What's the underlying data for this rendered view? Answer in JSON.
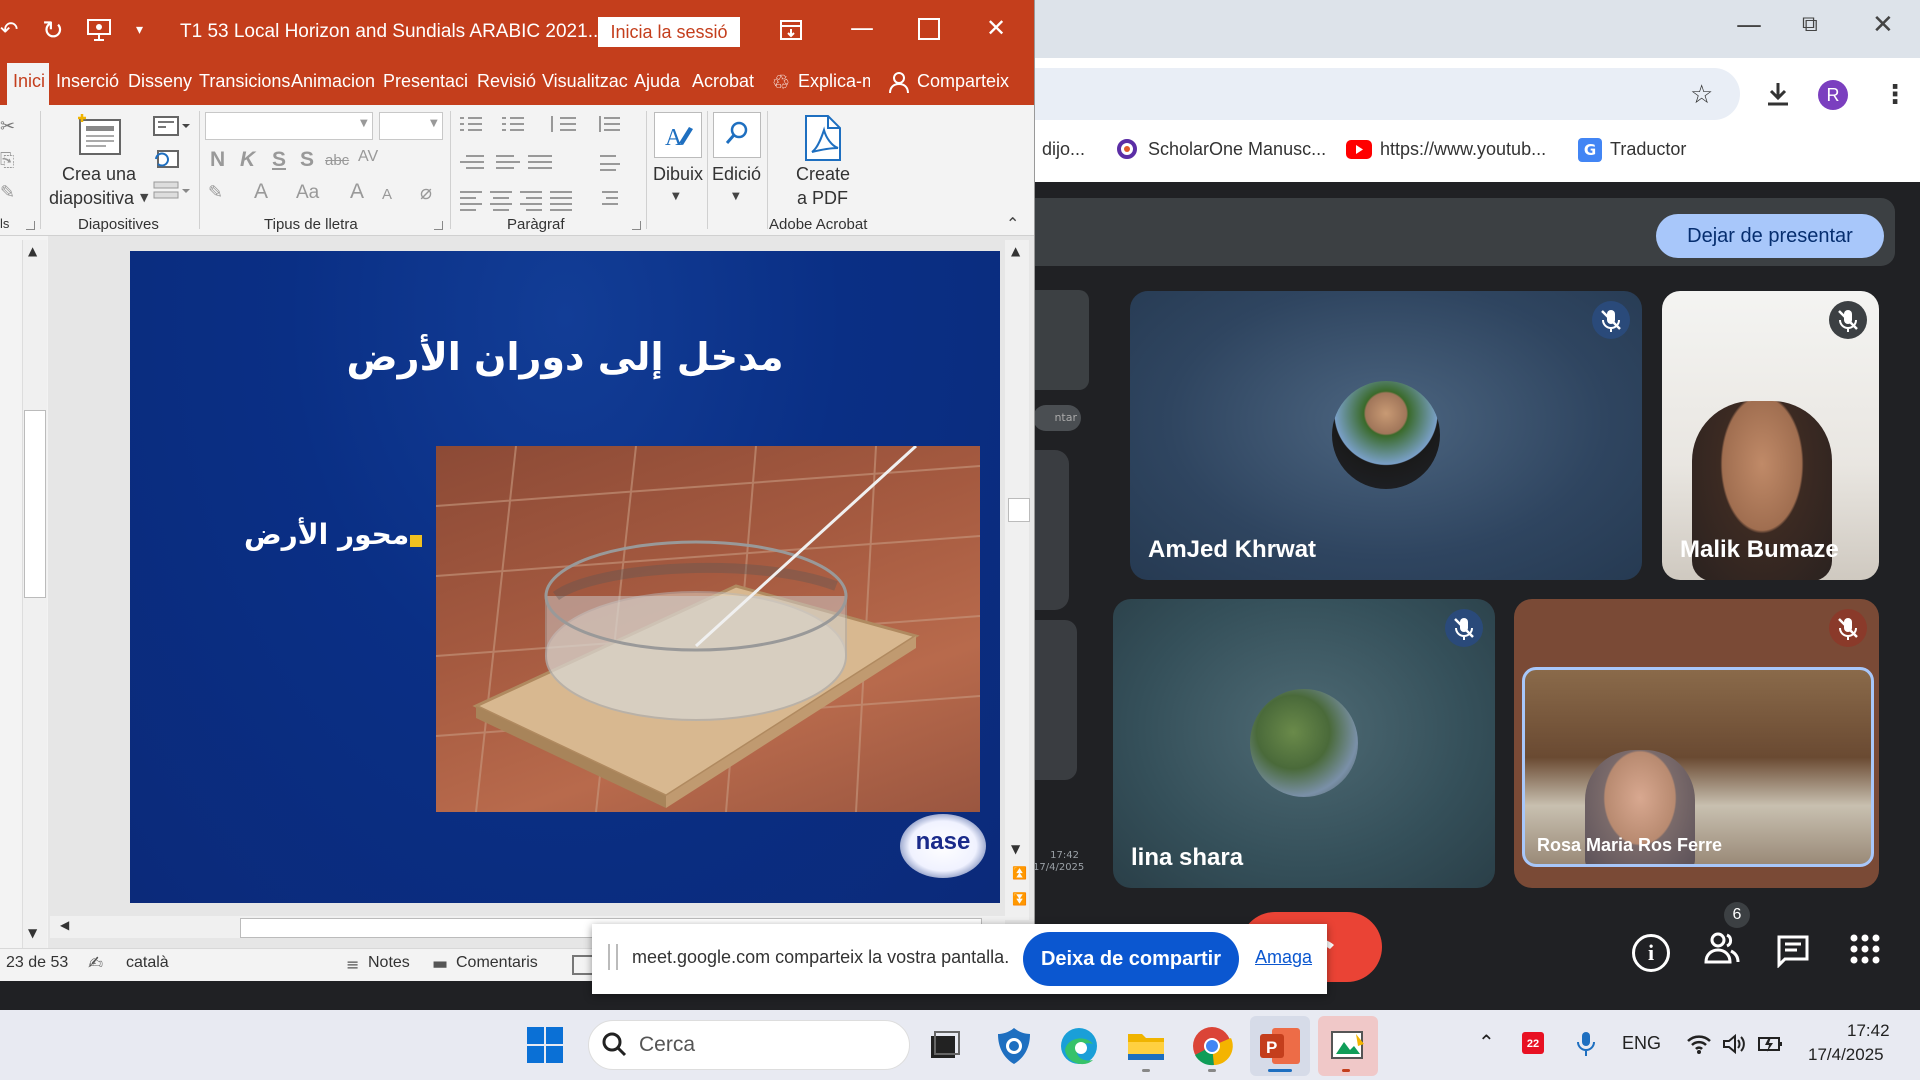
{
  "ppt": {
    "doc_title": "T1 53 Local Horizon and Sundials ARABIC 2021....",
    "signin_label": "Inicia la sessió",
    "tabs": [
      "Inici",
      "Inserció",
      "Disseny",
      "Transicions",
      "Animacion",
      "Presentacic",
      "Revisió",
      "Visualitzac",
      "Ajuda",
      "Acrobat"
    ],
    "tell_me": "Explica-m",
    "share": "Comparteix",
    "ribbon": {
      "new_slide_line1": "Crea una",
      "new_slide_line2": "diapositiva",
      "group_slides": "Diapositives",
      "group_font": "Tipus de lletra",
      "group_paragraph": "Paràgraf",
      "draw": "Dibuix",
      "edit": "Edició",
      "create_pdf_line1": "Create",
      "create_pdf_line2": "a PDF",
      "group_acrobat": "Adobe Acrobat",
      "bold": "N",
      "italic": "K",
      "underline": "S",
      "strike": "S",
      "abc": "abc",
      "av": "AV",
      "font_a": "A",
      "aa": "Aa",
      "grow": "A",
      "shrink": "A",
      "left_group": "ls"
    },
    "slide": {
      "title": "مدخل إلى دوران الأرض",
      "bullet": "محور الأرض",
      "logo_text": "nase"
    },
    "status": {
      "slide_count": "23 de 53",
      "language": "català",
      "notes": "Notes",
      "comments": "Comentaris"
    }
  },
  "chrome": {
    "avatar_letter": "R",
    "bookmarks": [
      "dijo...",
      "ScholarOne Manusc...",
      "https://www.youtub...",
      "Traductor"
    ]
  },
  "meet": {
    "stop_presenting": "Dejar de presentar",
    "participants": [
      {
        "name": "AmJed Khrwat"
      },
      {
        "name": "Malik Bumaze"
      },
      {
        "name": "lina shara"
      },
      {
        "name": "Rosa Maria Ros Ferre"
      }
    ],
    "people_count": "6",
    "mini_label": "ntar",
    "mini_time": "17:42",
    "mini_date": "17/4/2025"
  },
  "sharebar": {
    "message": "meet.google.com comparteix la vostra pantalla.",
    "stop_label": "Deixa de compartir",
    "hide_label": "Amaga"
  },
  "taskbar": {
    "search_placeholder": "Cerca",
    "lang": "ENG",
    "time": "17:42",
    "date": "17/4/2025",
    "calendar_badge": "22"
  },
  "colors": {
    "ppt_red": "#c43e1c",
    "meet_blue": "#a8c7fa",
    "share_blue": "#0b57d0",
    "end_call_red": "#ea4335"
  }
}
